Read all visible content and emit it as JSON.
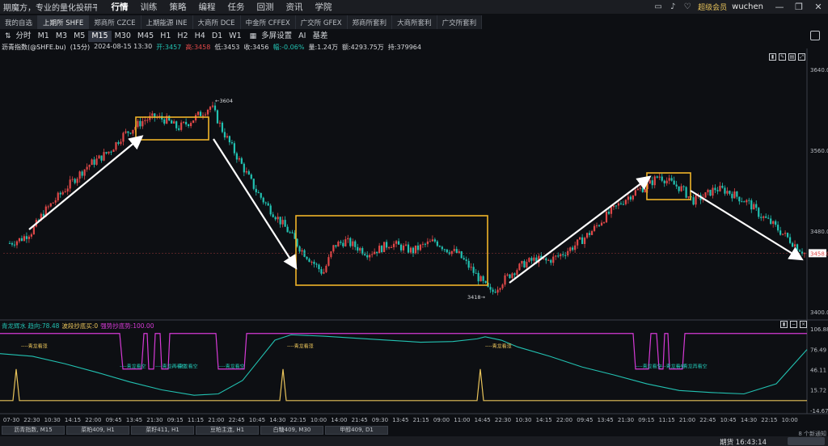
{
  "app": {
    "title": "期魔方，专业的量化投研平台",
    "menu": [
      "行情",
      "训练",
      "策略",
      "编程",
      "任务",
      "回测",
      "资讯",
      "学院"
    ],
    "active_menu": 0,
    "vip_label": "超级会员",
    "user": "wuchen"
  },
  "exchange_tabs": [
    "我的自选",
    "上期所 SHFE",
    "郑商所 CZCE",
    "上期能源 INE",
    "大商所 DCE",
    "中金所 CFFEX",
    "广交所 GFEX",
    "郑商所套利",
    "大商所套利",
    "广交所套利"
  ],
  "active_exchange_tab": 1,
  "periods": [
    "分时",
    "M1",
    "M3",
    "M5",
    "M15",
    "M30",
    "M45",
    "H1",
    "H2",
    "H4",
    "D1",
    "W1"
  ],
  "active_period": "M15",
  "period_extras": [
    "多屏设置",
    "AI",
    "基差"
  ],
  "info": {
    "name": "沥青指数(@SHFE.bu)",
    "period": "(15分)",
    "date": "2024-08-15  13:30",
    "open": "开:3457",
    "high": "高:3458",
    "low": "低:3453",
    "close": "收:3456",
    "change": "幅:-0.06%",
    "volume": "量:1.24万",
    "amount": "额:4293.75万",
    "oi": "持:379964"
  },
  "chart_data": {
    "type": "candlestick",
    "y_axis_labels": [
      "3640.0",
      "3560.0",
      "3480.0",
      "3400.0"
    ],
    "ylim": [
      3395,
      3645
    ],
    "current_price_label": "3458.0",
    "annotations": [
      "←3604",
      "3418→"
    ],
    "x_tick_labels": [
      "07-30",
      "22:30",
      "10:30",
      "14:15",
      "22:00",
      "09:45",
      "13:45",
      "21:30",
      "09:15",
      "11:15",
      "21:00",
      "22:45",
      "10:45",
      "14:30",
      "22:15",
      "10:00",
      "14:00",
      "21:45",
      "09:30",
      "13:45",
      "21:15",
      "09:00",
      "11:00",
      "14:45",
      "22:30",
      "10:30",
      "14:15",
      "22:00",
      "09:45",
      "13:45",
      "21:30",
      "09:15",
      "11:15",
      "21:00",
      "22:45",
      "10:45",
      "14:30",
      "22:15",
      "10:00"
    ],
    "close_trend": [
      3468,
      3472,
      3480,
      3498,
      3510,
      3522,
      3534,
      3545,
      3552,
      3560,
      3574,
      3582,
      3590,
      3593,
      3590,
      3582,
      3588,
      3596,
      3604,
      3580,
      3560,
      3540,
      3520,
      3505,
      3492,
      3478,
      3462,
      3450,
      3438,
      3466,
      3470,
      3464,
      3458,
      3462,
      3468,
      3464,
      3460,
      3466,
      3470,
      3462,
      3458,
      3445,
      3432,
      3418,
      3430,
      3440,
      3448,
      3452,
      3450,
      3455,
      3462,
      3470,
      3480,
      3492,
      3502,
      3512,
      3520,
      3525,
      3535,
      3528,
      3522,
      3510,
      3514,
      3522,
      3520,
      3514,
      3508,
      3496,
      3488,
      3478,
      3468,
      3458
    ],
    "indicator": {
      "name": "青龙辉水 趋向:78.48",
      "value2": "波段抄底买:0",
      "value3": "强势抄底势:100.00",
      "y_axis_labels": [
        "106.88",
        "76.49",
        "46.11",
        "15.72",
        "-14.67"
      ],
      "ylim": [
        -14.67,
        106.88
      ],
      "event_labels": [
        "青龙看涨",
        "青龙看空",
        "青龙再看空",
        "青龙看空",
        "青龙看空",
        "青龙看涨",
        "青龙看空",
        "青龙看涨",
        "青龙看空",
        "青龙再看空"
      ]
    }
  },
  "bottom_tabs": [
    "沥青指数, M15",
    "菜粕409, H1",
    "菜籽411, H1",
    "豆粕主连, H1",
    "白糖409, M30",
    "甲醇409, D1"
  ],
  "status": {
    "time": "期货 16:43:14",
    "unread": "8 个新通知"
  },
  "colors": {
    "up": "#e04848",
    "down": "#22c2b2",
    "box": "#f0b429",
    "arrow": "#ffffff",
    "indicator_green": "#22c2b2",
    "indicator_magenta": "#d63ad6",
    "indicator_yellow": "#e8c35a"
  }
}
